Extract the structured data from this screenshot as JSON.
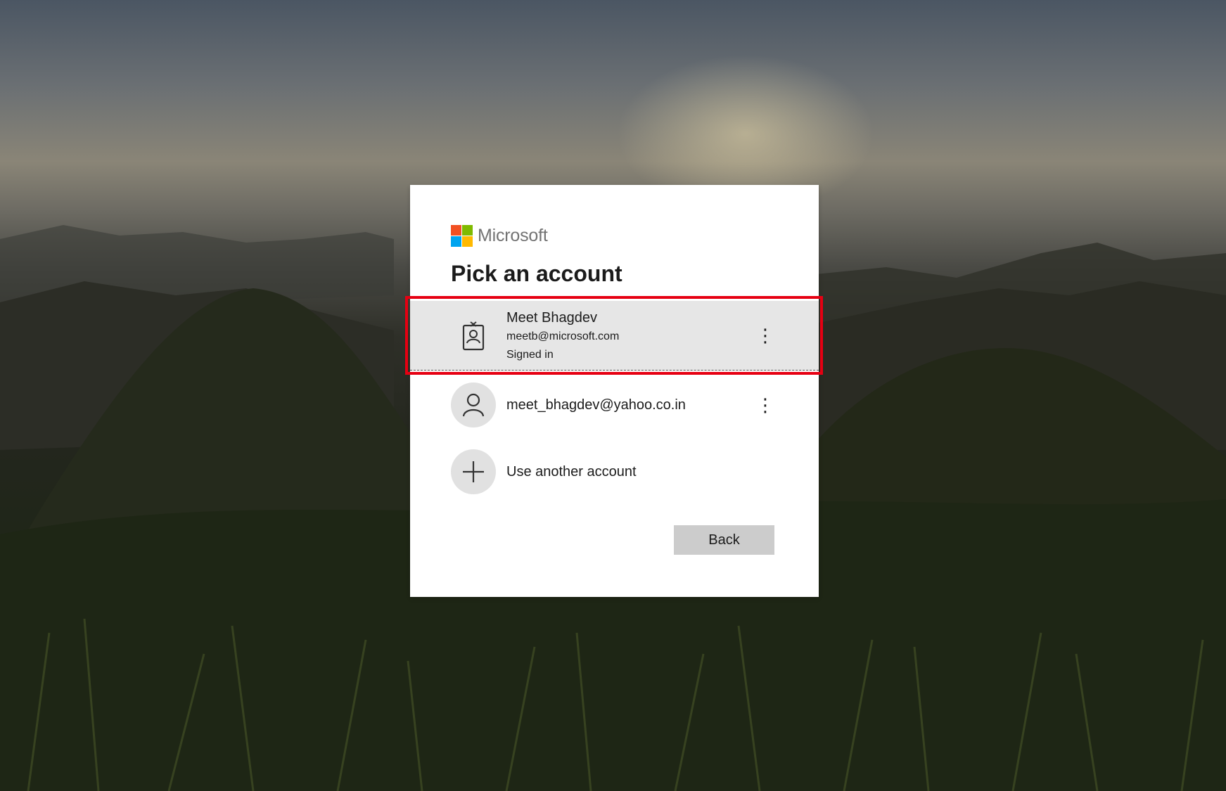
{
  "brand": {
    "name": "Microsoft",
    "logo_colors": [
      "#f25022",
      "#7fba00",
      "#00a4ef",
      "#ffb900"
    ]
  },
  "heading": "Pick an account",
  "accounts": [
    {
      "name": "Meet Bhagdev",
      "email": "meetb@microsoft.com",
      "status": "Signed in",
      "icon": "work-badge-icon",
      "selected": true
    },
    {
      "email": "meet_bhagdev@yahoo.co.in",
      "icon": "person-icon"
    }
  ],
  "use_another": {
    "label": "Use another account",
    "icon": "plus-icon"
  },
  "more_options_icon": "vertical-ellipsis-icon",
  "back_label": "Back",
  "colors": {
    "highlight": "#e60012",
    "selected_row": "#e6e6e6",
    "button": "#cccccc"
  }
}
